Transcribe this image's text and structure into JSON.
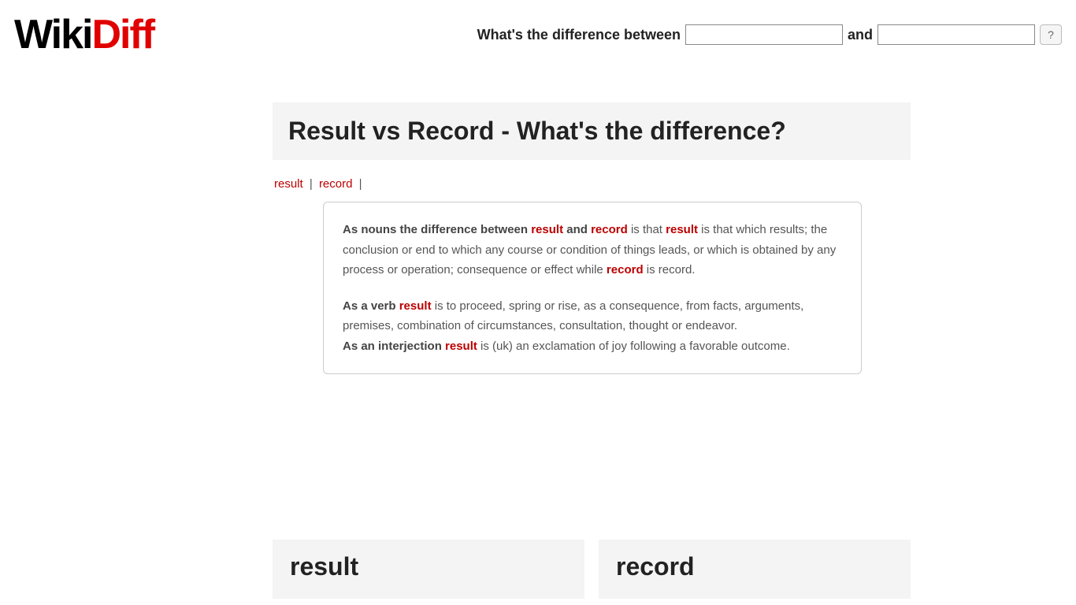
{
  "logo": {
    "part1": "Wiki",
    "part2": "Diff"
  },
  "search": {
    "prompt": "What's the difference between",
    "and": "and",
    "help": "?",
    "val1": "",
    "val2": ""
  },
  "title": "Result vs Record - What's the difference?",
  "crumbs": {
    "a": "result",
    "b": "record",
    "bar": "|"
  },
  "summary": {
    "p1_lead": "As nouns the difference between ",
    "p1_t1": "result",
    "p1_mid1": " and ",
    "p1_t2": "record",
    "p1_mid2": " is that ",
    "p1_t3": "result",
    "p1_body": " is that which results; the conclusion or end to which any course or condition of things leads, or which is obtained by any process or operation; consequence or effect while ",
    "p1_t4": "record",
    "p1_tail": " is record.",
    "p2_lead": "As a verb ",
    "p2_t1": "result",
    "p2_body": " is to proceed, spring or rise, as a consequence, from facts, arguments, premises, combination of circumstances, consultation, thought or endeavor.",
    "p3_lead": "As an interjection ",
    "p3_t1": "result",
    "p3_body": " is (uk) an exclamation of joy following a favorable outcome."
  },
  "columns": {
    "left": "result",
    "right": "record"
  }
}
